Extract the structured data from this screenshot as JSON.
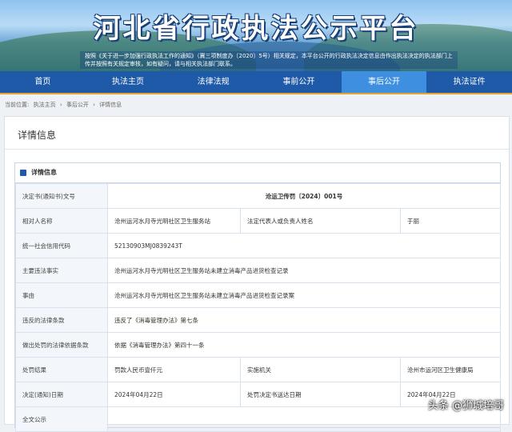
{
  "header": {
    "title": "河北省行政执法公示平台",
    "notice": "按照《关于进一步加强行政执法工作的通知》（冀三项制度办〔2020〕5号）相关规定，本平台公开的行政执法决定信息由作出执法决定的执法部门上传并按照有关规定审核，如有疑问，请与相关执法部门联系。"
  },
  "nav": [
    "首页",
    "执法主页",
    "法律法规",
    "事前公开",
    "事后公开",
    "执法证件"
  ],
  "nav_active": "事后公开",
  "breadcrumb": [
    "当前位置:",
    "执法主页",
    "›",
    "事后公开",
    "›",
    "详情信息"
  ],
  "panel_title": "详情信息",
  "card_title": "详情信息",
  "rows": {
    "decision_no": {
      "label": "决定书(通知书)文号",
      "value": "沧运卫传罚〔2024〕001号"
    },
    "party": {
      "label": "相对人名称",
      "value": "沧州运河水月寺光明社区卫生服务站",
      "label2": "法定代表人或负责人姓名",
      "value2": "于丽"
    },
    "credit_code": {
      "label": "统一社会信用代码",
      "value": "52130903MJ0839243T"
    },
    "facts": {
      "label": "主要违法事实",
      "value": "沧州运河水月寺光明社区卫生服务站未建立消毒产品进货检查记录"
    },
    "cause": {
      "label": "事由",
      "value": "沧州运河水月寺光明社区卫生服务站未建立消毒产品进货检查记录案"
    },
    "violated_law": {
      "label": "违反的法律条款",
      "value": "违反了《消毒管理办法》第七条"
    },
    "basis": {
      "label": "做出处罚的法律依据条款",
      "value": "依据《消毒管理办法》第四十一条"
    },
    "result": {
      "label": "处罚结果",
      "value": "罚款人民币壹仟元",
      "label2": "实施机关",
      "value2": "沧州市运河区卫生健康局"
    },
    "dates": {
      "label": "决定(通知)日期",
      "value": "2024年04月22日",
      "label2": "处罚决定书送达日期",
      "value2": "2024年04月22日"
    },
    "full_text": {
      "label": "全文公示",
      "value": ""
    }
  },
  "watermark": "头条 @狮城培哥"
}
